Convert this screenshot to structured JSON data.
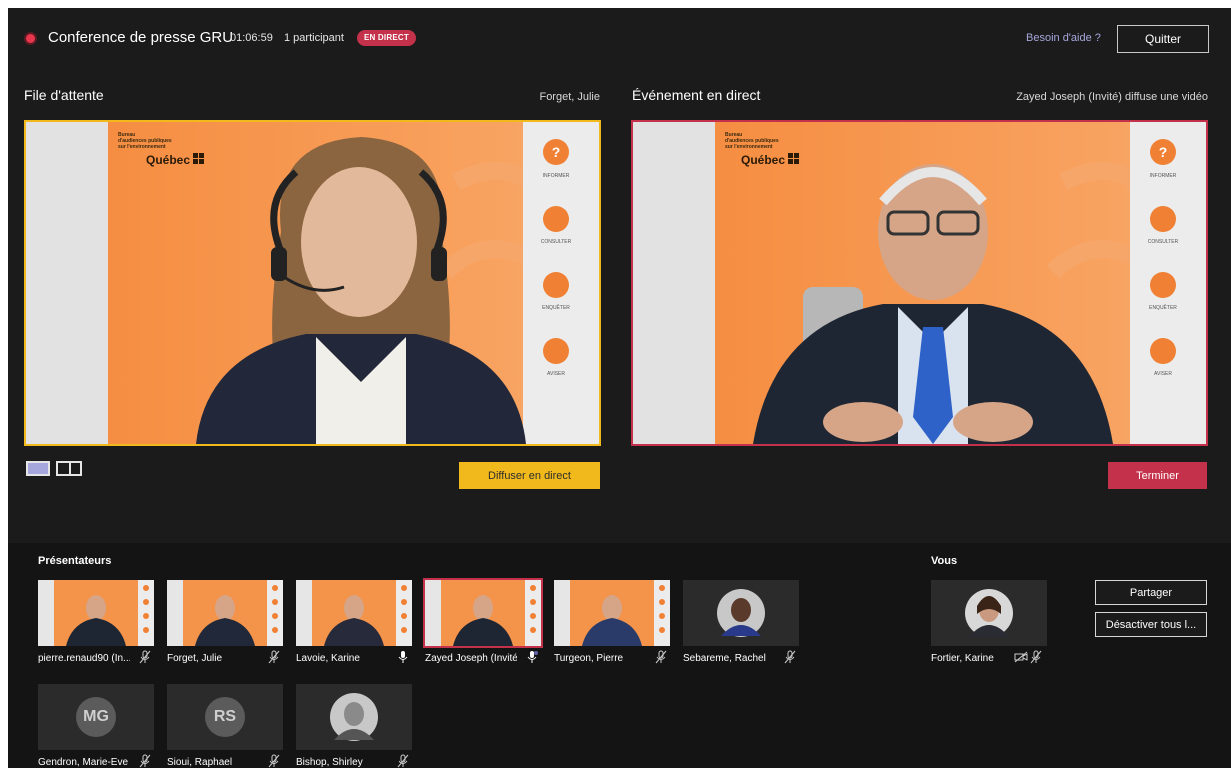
{
  "header": {
    "title": "Conference de presse GRU",
    "timer": "01:06:59",
    "participants": "1 participant",
    "live_badge": "EN DIRECT",
    "help_link": "Besoin d'aide ?",
    "quit_button": "Quitter"
  },
  "queue_panel": {
    "label": "File d'attente",
    "presenter": "Forget, Julie",
    "broadcast_button": "Diffuser en direct"
  },
  "live_panel": {
    "label": "Événement en direct",
    "status": "Zayed Joseph (Invité) diffuse une vidéo",
    "end_button": "Terminer"
  },
  "slide": {
    "org_line1": "Bureau",
    "org_line2": "d'audiences publiques",
    "org_line3": "sur l'environnement",
    "logo": "Québec",
    "menu": [
      "INFORMER",
      "CONSULTER",
      "ENQUÊTER",
      "AVISER"
    ]
  },
  "presenters": {
    "label": "Présentateurs",
    "items": [
      {
        "name": "pierre.renaud90 (In...",
        "mic": "muted"
      },
      {
        "name": "Forget, Julie",
        "mic": "muted"
      },
      {
        "name": "Lavoie, Karine",
        "mic": "on"
      },
      {
        "name": "Zayed Joseph (Invité)",
        "mic": "speaking"
      },
      {
        "name": "Turgeon, Pierre",
        "mic": "muted"
      },
      {
        "name": "Sebareme, Rachel",
        "mic": "muted"
      },
      {
        "name": "Gendron, Marie-Eve",
        "mic": "muted",
        "initials": "MG"
      },
      {
        "name": "Sioui, Raphael",
        "mic": "muted",
        "initials": "RS"
      },
      {
        "name": "Bishop, Shirley",
        "mic": "muted"
      }
    ]
  },
  "you": {
    "label": "Vous",
    "name": "Fortier, Karine",
    "share_button": "Partager",
    "mute_all_button": "Désactiver tous l..."
  },
  "colors": {
    "accent_yellow": "#f1b91c",
    "accent_red": "#c4314b",
    "link_purple": "#a6a7dc",
    "slide_orange": "#f4934a"
  }
}
